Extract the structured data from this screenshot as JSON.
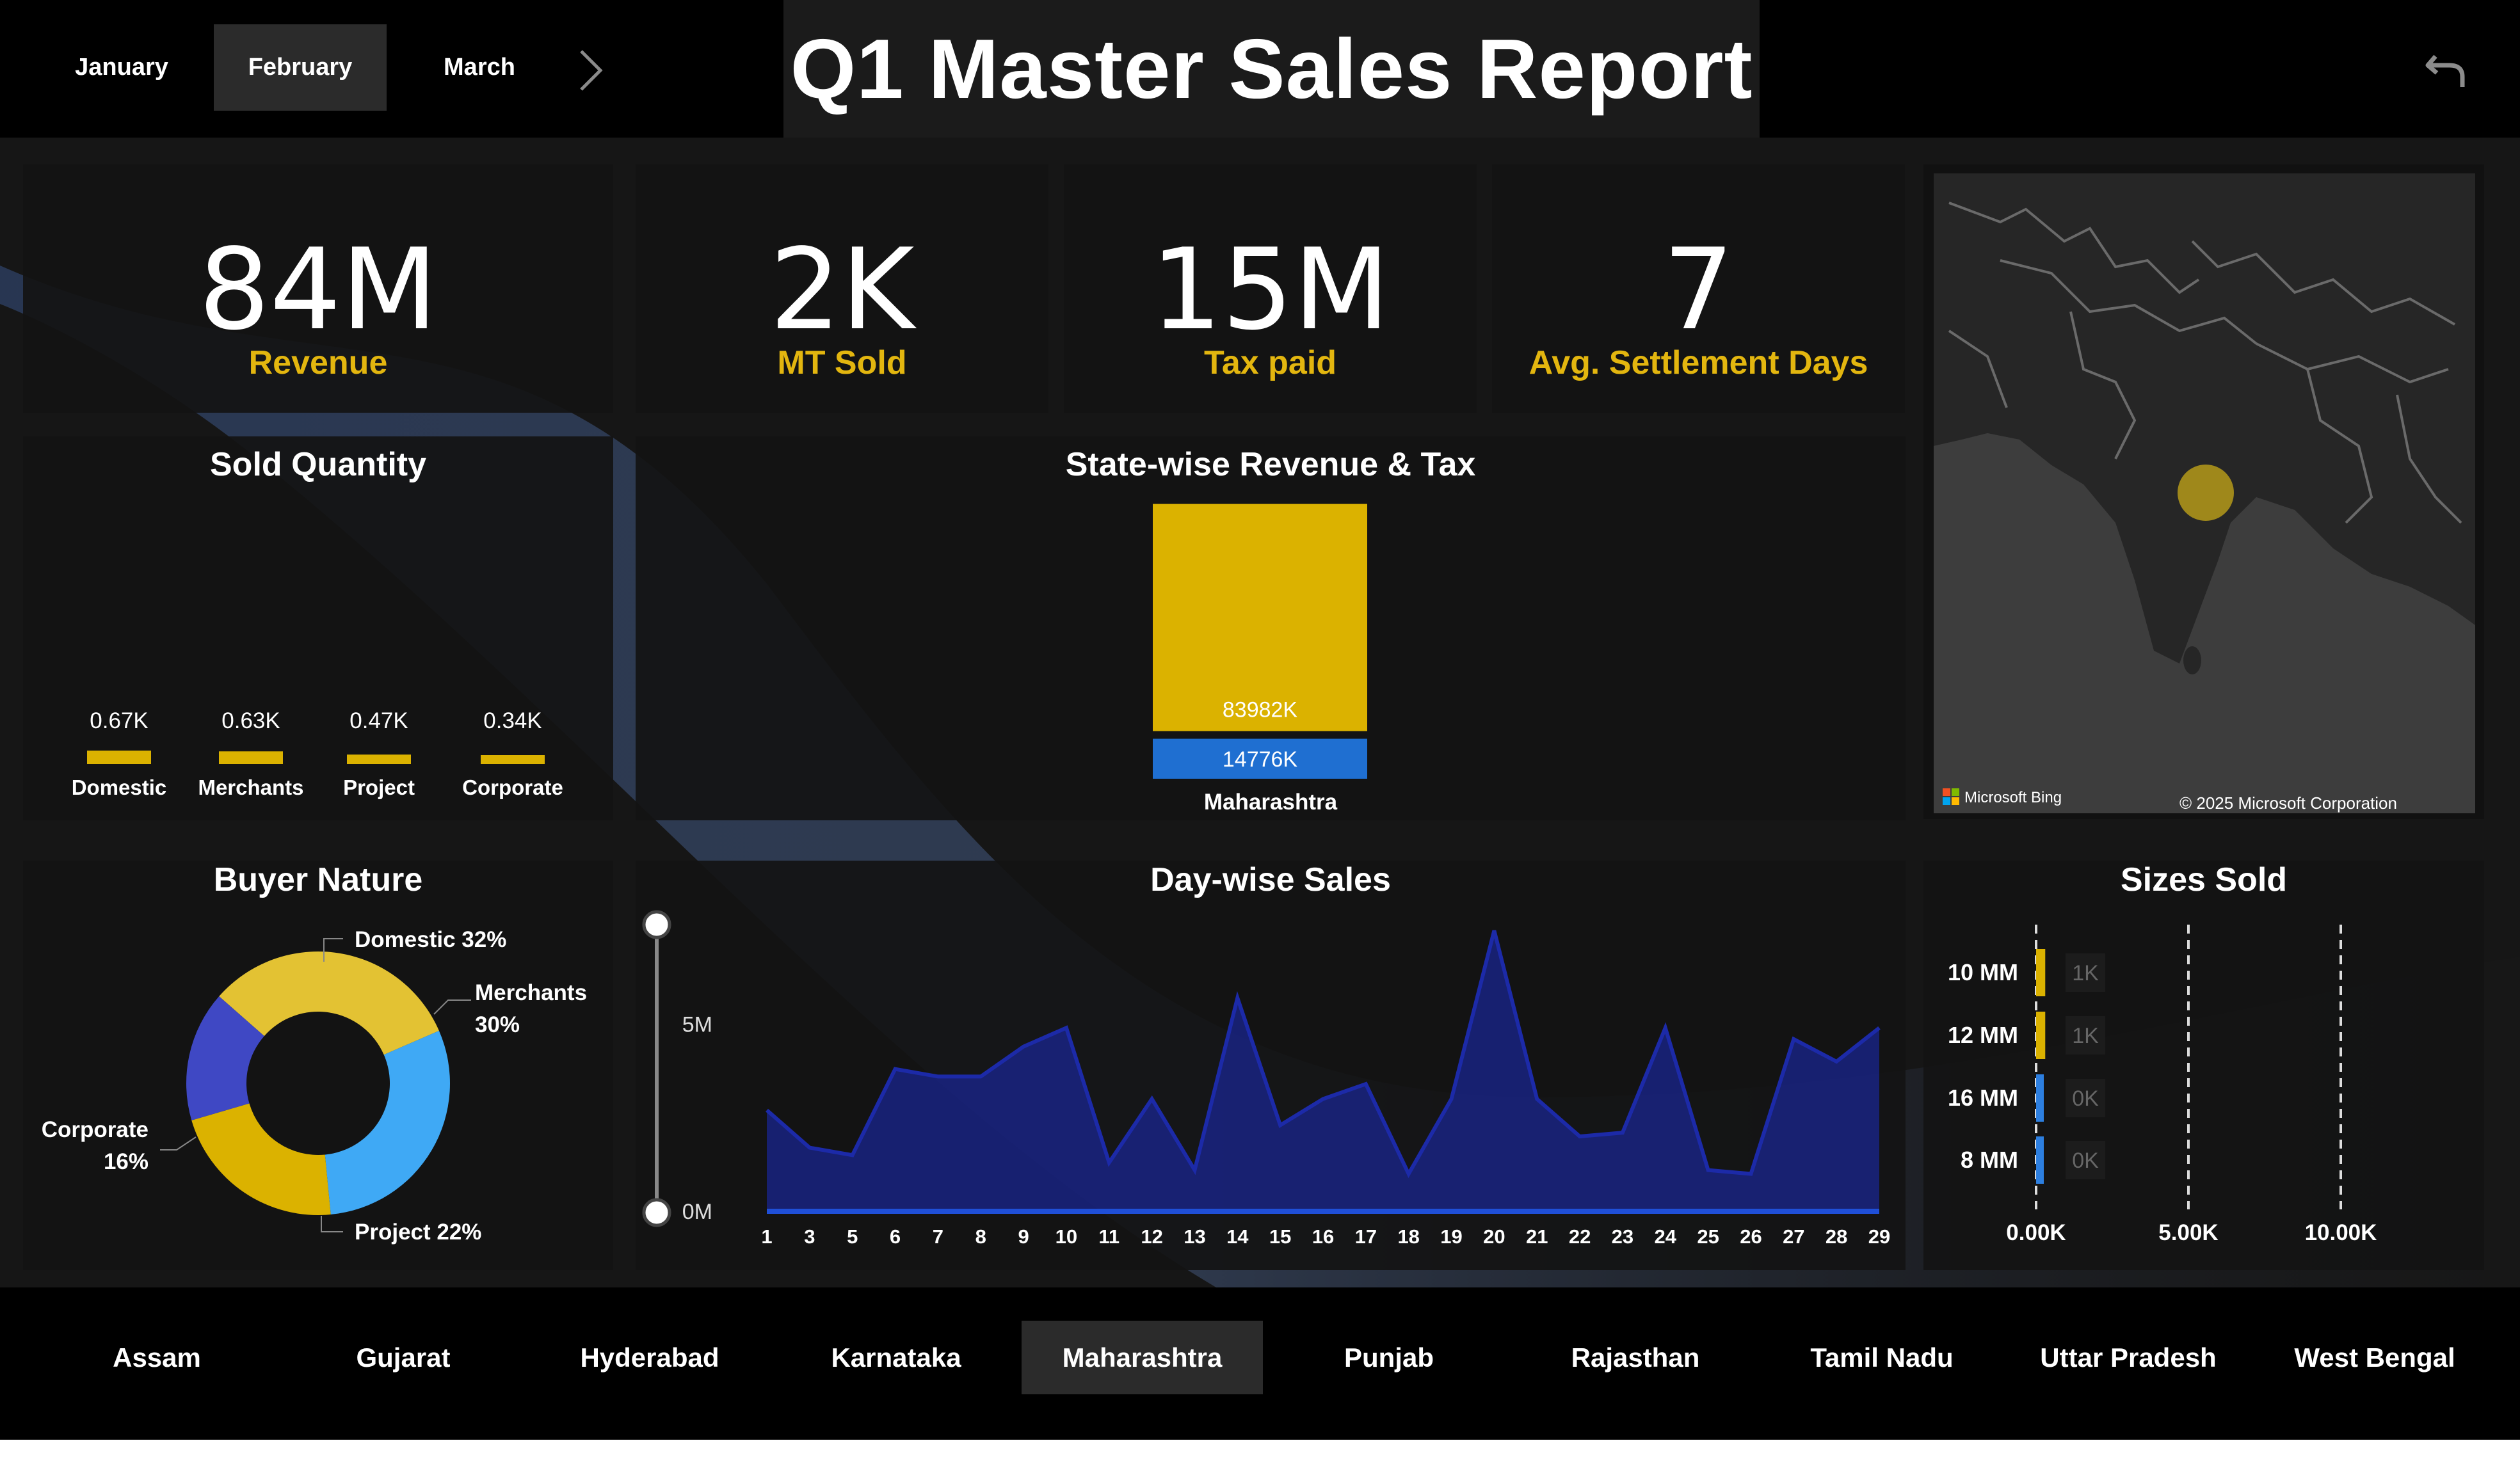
{
  "header": {
    "months": [
      {
        "label": "January",
        "active": false
      },
      {
        "label": "February",
        "active": true
      },
      {
        "label": "March",
        "active": false
      }
    ],
    "next_icon": "chevron-right-icon",
    "title": "Q1 Master Sales Report",
    "back_icon": "undo-icon"
  },
  "kpis": [
    {
      "value": "84M",
      "label": "Revenue"
    },
    {
      "value": "2K",
      "label": "MT Sold"
    },
    {
      "value": "15M",
      "label": "Tax paid"
    },
    {
      "value": "7",
      "label": "Avg. Settlement Days"
    }
  ],
  "colors": {
    "accent_gold": "#e3b60f",
    "bar_gold": "#dbb200",
    "bar_blue": "#1f6fd1",
    "donut_blue": "#3fa9f5",
    "donut_indigo": "#3f48c4",
    "donut_yellow": "#e3c233",
    "area_navy": "#1a2690",
    "line_navy": "#1c2aa8"
  },
  "sold_quantity": {
    "title": "Sold Quantity",
    "chart_data": {
      "type": "bar",
      "categories": [
        "Domestic",
        "Merchants",
        "Project",
        "Corporate"
      ],
      "values": [
        0.67,
        0.63,
        0.47,
        0.34
      ],
      "value_labels": [
        "0.67K",
        "0.63K",
        "0.47K",
        "0.34K"
      ],
      "unit": "K"
    }
  },
  "state_revenue": {
    "title": "State-wise Revenue & Tax",
    "chart_data": {
      "type": "bar",
      "stacked": true,
      "categories": [
        "Maharashtra"
      ],
      "series": [
        {
          "name": "Revenue",
          "values": [
            83982
          ],
          "label": "83982K",
          "color": "#dbb200"
        },
        {
          "name": "Tax",
          "values": [
            14776
          ],
          "label": "14776K",
          "color": "#1f6fd1"
        }
      ]
    }
  },
  "map": {
    "bing_label": "Microsoft Bing",
    "copyright": "© 2025 Microsoft Corporation",
    "marker_state": "Maharashtra"
  },
  "buyer_nature": {
    "title": "Buyer Nature",
    "chart_data": {
      "type": "pie",
      "donut": true,
      "slices": [
        {
          "label": "Domestic 32%",
          "value": 32,
          "color": "#e3c233"
        },
        {
          "label": "Merchants",
          "label2": "30%",
          "value": 30,
          "color": "#3fa9f5"
        },
        {
          "label": "Project 22%",
          "value": 22,
          "color": "#e6b800"
        },
        {
          "label": "Corporate",
          "label2": "16%",
          "value": 16,
          "color": "#3f48c4"
        }
      ]
    }
  },
  "day_sales": {
    "title": "Day-wise Sales",
    "chart_data": {
      "type": "area",
      "x": [
        1,
        2,
        3,
        4,
        5,
        6,
        7,
        8,
        9,
        10,
        11,
        12,
        13,
        14,
        15,
        16,
        17,
        18,
        19,
        20,
        21,
        22,
        23,
        24,
        25,
        26,
        27,
        28,
        29
      ],
      "x_tick_labels": [
        "1",
        "3",
        "5",
        "6",
        "7",
        "8",
        "9",
        "10",
        "11",
        "12",
        "13",
        "14",
        "15",
        "16",
        "17",
        "18",
        "19",
        "20",
        "21",
        "22",
        "23",
        "24",
        "25",
        "26",
        "27",
        "28",
        "29"
      ],
      "values": [
        2.7,
        1.7,
        1.5,
        3.8,
        3.6,
        3.6,
        4.4,
        4.9,
        1.3,
        3.0,
        1.1,
        5.7,
        2.3,
        3.0,
        3.4,
        1.0,
        3.0,
        7.5,
        3.0,
        2.0,
        2.1,
        4.9,
        1.1,
        1.0,
        4.6,
        4.0,
        4.9
      ],
      "y_ticks": [
        "0M",
        "5M"
      ],
      "ylim": [
        0,
        8
      ]
    }
  },
  "sizes_sold": {
    "title": "Sizes Sold",
    "chart_data": {
      "type": "bar",
      "orientation": "horizontal",
      "categories": [
        "10 MM",
        "12 MM",
        "16 MM",
        "8 MM"
      ],
      "values": [
        1.2,
        1.2,
        0.4,
        0.4
      ],
      "value_labels": [
        "1K",
        "1K",
        "0K",
        "0K"
      ],
      "colors": [
        "#dbb200",
        "#dbb200",
        "#2d7fe0",
        "#2d7fe0"
      ],
      "x_ticks": [
        "0.00K",
        "5.00K",
        "10.00K"
      ],
      "xlim": [
        0,
        10
      ]
    }
  },
  "states": [
    {
      "label": "Assam",
      "active": false
    },
    {
      "label": "Gujarat",
      "active": false
    },
    {
      "label": "Hyderabad",
      "active": false
    },
    {
      "label": "Karnataka",
      "active": false
    },
    {
      "label": "Maharashtra",
      "active": true
    },
    {
      "label": "Punjab",
      "active": false
    },
    {
      "label": "Rajasthan",
      "active": false
    },
    {
      "label": "Tamil Nadu",
      "active": false
    },
    {
      "label": "Uttar Pradesh",
      "active": false
    },
    {
      "label": "West Bengal",
      "active": false
    }
  ]
}
